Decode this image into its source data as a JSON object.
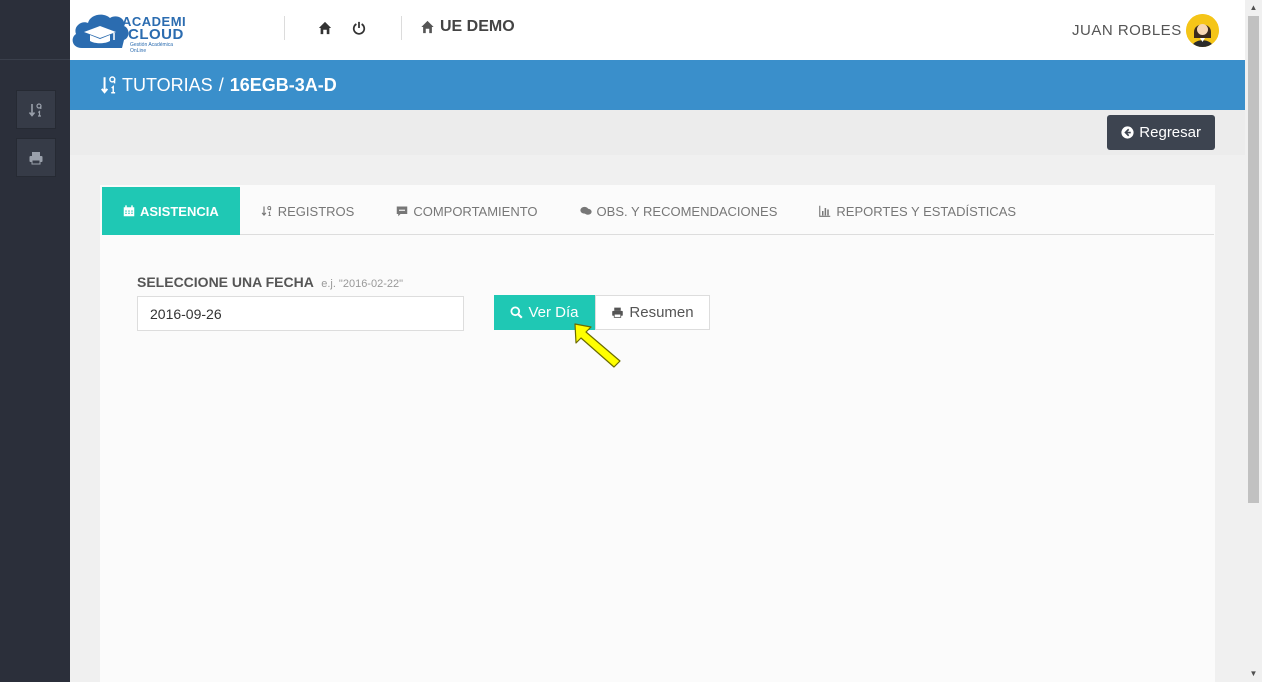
{
  "header": {
    "logo_line1": "ACADEMI",
    "logo_line2": "CLOUD",
    "logo_tagline": "Gestión Académica OnLine",
    "school_name": "UE DEMO",
    "user_name": "JUAN ROBLES"
  },
  "icons": {
    "home": "home-icon",
    "power": "power-icon",
    "school": "house-icon",
    "sort": "sort-numeric-icon",
    "print": "print-icon",
    "back": "arrow-circle-left-icon",
    "calendar": "calendar-icon",
    "comment": "comment-icon",
    "comments": "comments-icon",
    "chart": "bar-chart-icon",
    "search": "search-icon"
  },
  "title": {
    "section": "TUTORIAS",
    "separator": "/",
    "group": "16EGB-3A-D"
  },
  "actions": {
    "back_label": "Regresar"
  },
  "tabs": [
    {
      "label": "ASISTENCIA",
      "active": true
    },
    {
      "label": "REGISTROS",
      "active": false
    },
    {
      "label": "COMPORTAMIENTO",
      "active": false
    },
    {
      "label": "OBS. Y RECOMENDACIONES",
      "active": false
    },
    {
      "label": "REPORTES Y ESTADÍSTICAS",
      "active": false
    }
  ],
  "form": {
    "date_label": "SELECCIONE UNA FECHA",
    "date_hint": "e.j. \"2016-02-22\"",
    "date_value": "2016-09-26",
    "view_day_label": "Ver Día",
    "summary_label": "Resumen"
  },
  "colors": {
    "sidebar": "#2b2f3a",
    "title_bar": "#3a8fcb",
    "accent": "#1fc8b4",
    "back_button": "#3d4450",
    "pointer": "#ffff00"
  }
}
